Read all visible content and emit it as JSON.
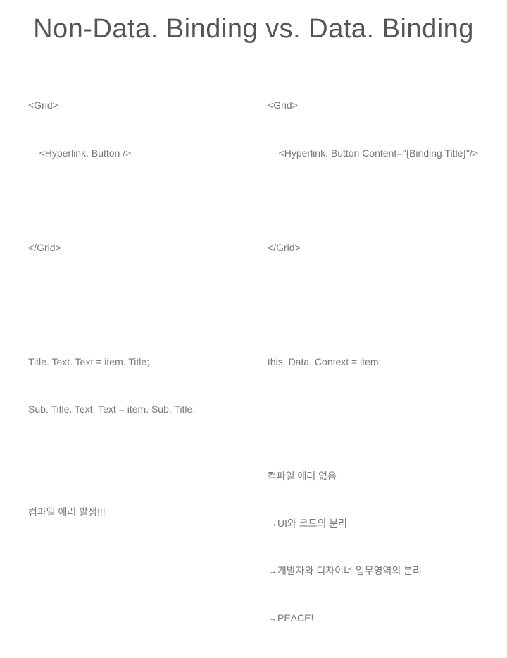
{
  "title": "Non-Data. Binding vs. Data. Binding",
  "left": {
    "xaml_open": "<Grid>",
    "xaml_child": "    <Hyperlink. Button />",
    "xaml_close": "</Grid>",
    "code1": "Title. Text. Text = item. Title;",
    "code2": "Sub. Title. Text. Text = item. Sub. Title;",
    "note": "컴파일 에러 발생!!!"
  },
  "right": {
    "xaml_open": "<Grid>",
    "xaml_child": "    <Hyperlink. Button Content=\"{Binding Title}\"/>",
    "xaml_close": "</Grid>",
    "code1": "this. Data. Context = item;",
    "note1": "컴파일 에러 없음",
    "note2": "UI와 코드의 분리",
    "note3": "개발자와 디자이너 업무영역의 분리",
    "note4": "PEACE!"
  }
}
